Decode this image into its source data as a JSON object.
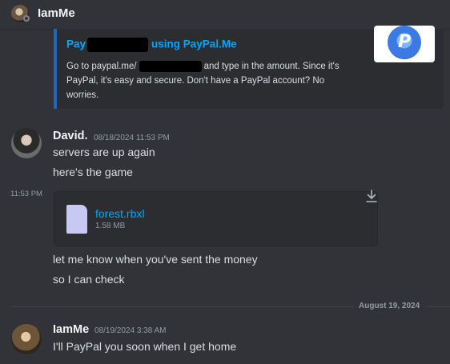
{
  "header": {
    "channel_name": "IamMe",
    "avatar_icon": "user-avatar-icon",
    "status": "offline"
  },
  "embed": {
    "accent_color": "#1e66c4",
    "title_before": "Pay",
    "title_after": "using PayPal.Me",
    "desc_before": "Go to paypal.me/",
    "desc_after": "and type in the amount. Since it's PayPal, it's easy and secure. Don't have a PayPal account? No worries.",
    "thumbnail_icon": "paypal-logo-icon",
    "thumbnail_letter": "P"
  },
  "messages": [
    {
      "author": "David.",
      "timestamp": "08/18/2024 11:53 PM",
      "lines": [
        "servers are up again",
        "here's the game"
      ]
    },
    {
      "side_time": "11:53 PM",
      "attachment": {
        "name": "forest.rbxl",
        "size": "1.58 MB",
        "icon": "file-icon",
        "action_icon": "download-icon"
      },
      "lines": [
        "let me know when you've sent the money",
        "so I can check"
      ]
    },
    {
      "author": "IamMe",
      "timestamp": "08/19/2024 3:38 AM",
      "lines": [
        "I'll PayPal you soon when I get home"
      ]
    }
  ],
  "date_divider": "August 19, 2024"
}
